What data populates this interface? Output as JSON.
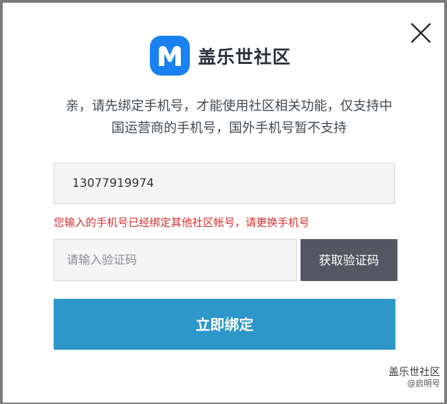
{
  "header": {
    "brand_name": "盖乐世社区",
    "logo_letter": "M"
  },
  "notice": {
    "line1": "亲，请先绑定手机号，才能使用社区相关功能，仅支持中",
    "line2": "国运营商的手机号，国外手机号暂不支持"
  },
  "phone_field": {
    "value": "13077919974"
  },
  "error_message": "您输入的手机号已经绑定其他社区帐号，请更换手机号",
  "code_field": {
    "placeholder": "请输入验证码",
    "value": ""
  },
  "buttons": {
    "get_code_label": "获取验证码",
    "bind_label": "立即绑定"
  },
  "watermark": {
    "title": "盖乐世社区",
    "sub": "@启明号"
  },
  "colors": {
    "brand_blue": "#1a82f0",
    "error_red": "#d32f2f",
    "bind_button": "#2d97c9",
    "get_code_button": "#545762"
  },
  "icons": {
    "close": "close-icon",
    "logo": "logo-icon"
  }
}
